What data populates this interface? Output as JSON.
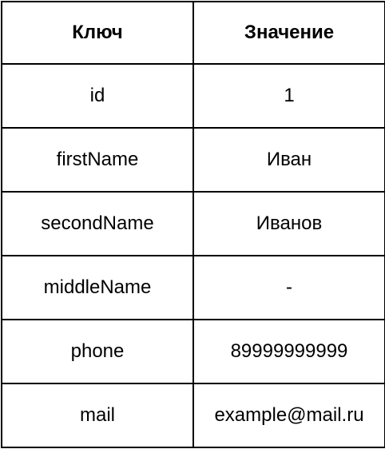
{
  "table": {
    "headers": {
      "key": "Ключ",
      "value": "Значение"
    },
    "rows": [
      {
        "key": "id",
        "value": "1"
      },
      {
        "key": "firstName",
        "value": "Иван"
      },
      {
        "key": "secondName",
        "value": "Иванов"
      },
      {
        "key": "middleName",
        "value": "-"
      },
      {
        "key": "phone",
        "value": "89999999999"
      },
      {
        "key": "mail",
        "value": "example@mail.ru"
      }
    ]
  }
}
